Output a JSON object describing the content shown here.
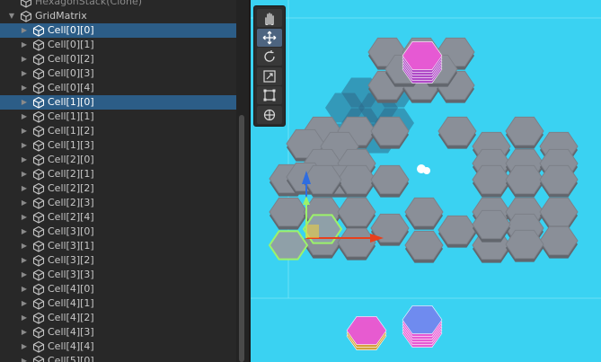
{
  "hierarchy": {
    "items": [
      {
        "label": "HexagonStack(Clone)",
        "depth": 0,
        "arrow": "",
        "faded": true
      },
      {
        "label": "GridMatrix",
        "depth": 0,
        "arrow": "expanded"
      },
      {
        "label": "Cell[0][0]",
        "depth": 1,
        "arrow": "collapsed",
        "selected": true
      },
      {
        "label": "Cell[0][1]",
        "depth": 1,
        "arrow": "collapsed"
      },
      {
        "label": "Cell[0][2]",
        "depth": 1,
        "arrow": "collapsed"
      },
      {
        "label": "Cell[0][3]",
        "depth": 1,
        "arrow": "collapsed"
      },
      {
        "label": "Cell[0][4]",
        "depth": 1,
        "arrow": "collapsed"
      },
      {
        "label": "Cell[1][0]",
        "depth": 1,
        "arrow": "collapsed",
        "selected": true
      },
      {
        "label": "Cell[1][1]",
        "depth": 1,
        "arrow": "collapsed"
      },
      {
        "label": "Cell[1][2]",
        "depth": 1,
        "arrow": "collapsed"
      },
      {
        "label": "Cell[1][3]",
        "depth": 1,
        "arrow": "collapsed"
      },
      {
        "label": "Cell[2][0]",
        "depth": 1,
        "arrow": "collapsed"
      },
      {
        "label": "Cell[2][1]",
        "depth": 1,
        "arrow": "collapsed"
      },
      {
        "label": "Cell[2][2]",
        "depth": 1,
        "arrow": "collapsed"
      },
      {
        "label": "Cell[2][3]",
        "depth": 1,
        "arrow": "collapsed"
      },
      {
        "label": "Cell[2][4]",
        "depth": 1,
        "arrow": "collapsed"
      },
      {
        "label": "Cell[3][0]",
        "depth": 1,
        "arrow": "collapsed"
      },
      {
        "label": "Cell[3][1]",
        "depth": 1,
        "arrow": "collapsed"
      },
      {
        "label": "Cell[3][2]",
        "depth": 1,
        "arrow": "collapsed"
      },
      {
        "label": "Cell[3][3]",
        "depth": 1,
        "arrow": "collapsed"
      },
      {
        "label": "Cell[4][0]",
        "depth": 1,
        "arrow": "collapsed"
      },
      {
        "label": "Cell[4][1]",
        "depth": 1,
        "arrow": "collapsed"
      },
      {
        "label": "Cell[4][2]",
        "depth": 1,
        "arrow": "collapsed"
      },
      {
        "label": "Cell[4][3]",
        "depth": 1,
        "arrow": "collapsed"
      },
      {
        "label": "Cell[4][4]",
        "depth": 1,
        "arrow": "collapsed"
      },
      {
        "label": "Cell[5][0]",
        "depth": 1,
        "arrow": "collapsed"
      }
    ]
  },
  "toolbar": {
    "tools": [
      {
        "name": "hand-tool",
        "icon": "hand-icon",
        "active": false
      },
      {
        "name": "move-tool",
        "icon": "move-icon",
        "active": true
      },
      {
        "name": "rotate-tool",
        "icon": "rotate-icon",
        "active": false
      },
      {
        "name": "scale-tool",
        "icon": "scale-icon",
        "active": false
      },
      {
        "name": "rect-tool",
        "icon": "rect-transform-icon",
        "active": false
      },
      {
        "name": "transform-tool",
        "icon": "transform-icon",
        "active": false
      }
    ]
  },
  "colors": {
    "scene_background": "#3ad2f2",
    "hex_tile": "#8a8f98",
    "selection_outline": "#9cf26a",
    "stack_pink": "#e85ad4",
    "stack_blue": "#6d8cf0",
    "gizmo_x": "#e8401c",
    "gizmo_y": "#2f6de0",
    "gizmo_z": "#9cf26a",
    "selected_row": "#2c5d87"
  },
  "scene": {
    "stacks": [
      {
        "name": "pink-stack-top",
        "color": "pink",
        "layers": 6
      },
      {
        "name": "pink-stack-bottom",
        "color": "pink",
        "layers": 3
      },
      {
        "name": "blue-stack-bottom",
        "color": "blue",
        "layers": 6
      }
    ]
  }
}
